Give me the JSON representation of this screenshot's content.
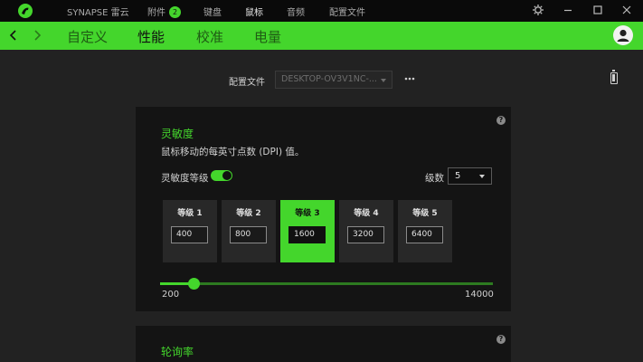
{
  "titlebar": {
    "nav": [
      {
        "label": "SYNAPSE 雷云",
        "active": false
      },
      {
        "label": "附件",
        "badge": "2",
        "active": false
      },
      {
        "label": "键盘",
        "active": false
      },
      {
        "label": "鼠标",
        "active": true
      },
      {
        "label": "音频",
        "active": false
      },
      {
        "label": "配置文件",
        "active": false
      }
    ],
    "window_buttons": [
      "gear-icon",
      "minimize-icon",
      "maximize-icon",
      "close-icon"
    ]
  },
  "tabs": [
    {
      "label": "自定义",
      "active": false
    },
    {
      "label": "性能",
      "active": true
    },
    {
      "label": "校准",
      "active": false
    },
    {
      "label": "电量",
      "active": false
    }
  ],
  "profile": {
    "label": "配置文件",
    "selected": "DESKTOP-OV3V1NC-..."
  },
  "sensitivity": {
    "title": "灵敏度",
    "description": "鼠标移动的每英寸点数 (DPI) 值。",
    "toggle_label": "灵敏度等级",
    "toggle_on": true,
    "levels_label": "级数",
    "levels_value": "5",
    "stages": [
      {
        "name": "等级 1",
        "value": "400",
        "active": false
      },
      {
        "name": "等级 2",
        "value": "800",
        "active": false
      },
      {
        "name": "等级 3",
        "value": "1600",
        "active": true
      },
      {
        "name": "等级 4",
        "value": "3200",
        "active": false
      },
      {
        "name": "等级 5",
        "value": "6400",
        "active": false
      }
    ],
    "slider": {
      "min": "200",
      "max": "14000",
      "min_value": 200,
      "max_value": 14000,
      "current": 1600
    }
  },
  "polling": {
    "title": "轮询率"
  },
  "colors": {
    "accent": "#44d62c",
    "titlebar": "#0a0a0a",
    "background": "#222222",
    "panel": "#141414"
  }
}
